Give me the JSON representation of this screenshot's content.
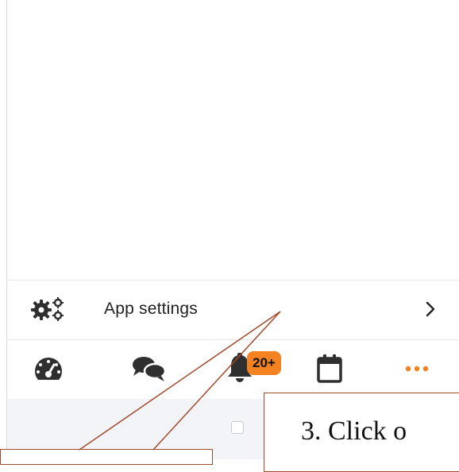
{
  "settings": {
    "label": "App settings",
    "icon": "gears-icon",
    "chevron_icon": "chevron-right-icon"
  },
  "bottom_nav": {
    "items": [
      {
        "name": "dashboard",
        "icon": "speedometer-icon"
      },
      {
        "name": "chat",
        "icon": "chat-bubbles-icon"
      },
      {
        "name": "notifications",
        "icon": "bell-icon",
        "badge": "20+"
      },
      {
        "name": "calendar",
        "icon": "calendar-icon"
      },
      {
        "name": "more",
        "icon": "more-dots-icon"
      }
    ]
  },
  "callout": {
    "text": "3. Click o"
  },
  "colors": {
    "accent": "#f58220",
    "callout_border": "#a44a2c",
    "icon_dark": "#2f2f2f",
    "text": "#212121"
  }
}
